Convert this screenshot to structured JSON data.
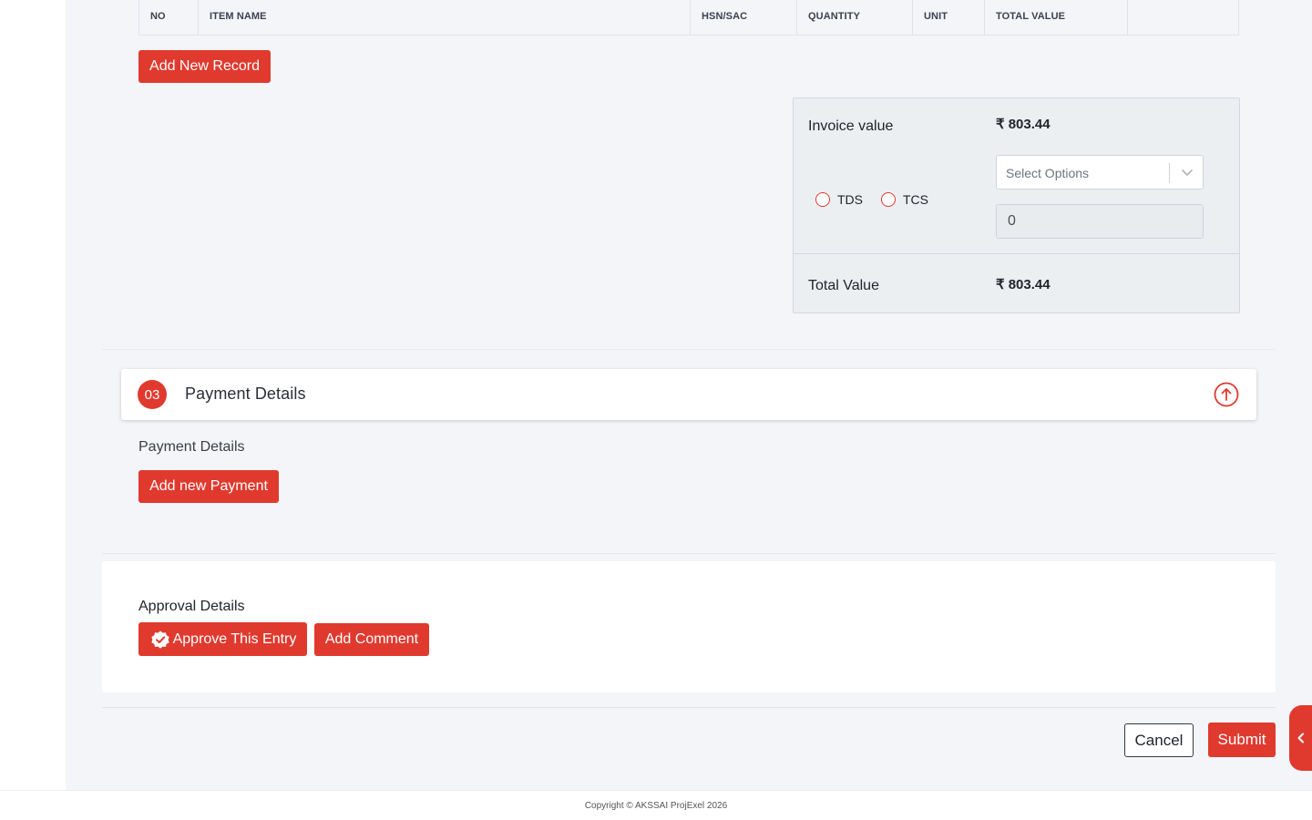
{
  "items_table": {
    "columns": [
      "NO",
      "ITEM NAME",
      "HSN/SAC",
      "QUANTITY",
      "UNIT",
      "TOTAL VALUE",
      ""
    ]
  },
  "add_record_label": "Add New Record",
  "summary": {
    "invoice_label": "Invoice value",
    "invoice_value": "₹ 803.44",
    "tds_label": "TDS",
    "tcs_label": "TCS",
    "select_placeholder": "Select Options",
    "tax_amount": "0",
    "total_label": "Total Value",
    "total_value": "₹ 803.44"
  },
  "payment": {
    "step": "03",
    "title": "Payment Details",
    "sub_label": "Payment Details",
    "add_payment_label": "Add new Payment"
  },
  "approval": {
    "label": "Approval Details",
    "approve_label": "Approve This Entry",
    "comment_label": "Add Comment"
  },
  "actions": {
    "cancel_label": "Cancel",
    "submit_label": "Submit"
  },
  "footer": {
    "copyright": "Copyright © AKSSAI ProjExel 2026"
  },
  "colors": {
    "accent": "#e03a2f",
    "background": "#f3f5f8"
  }
}
